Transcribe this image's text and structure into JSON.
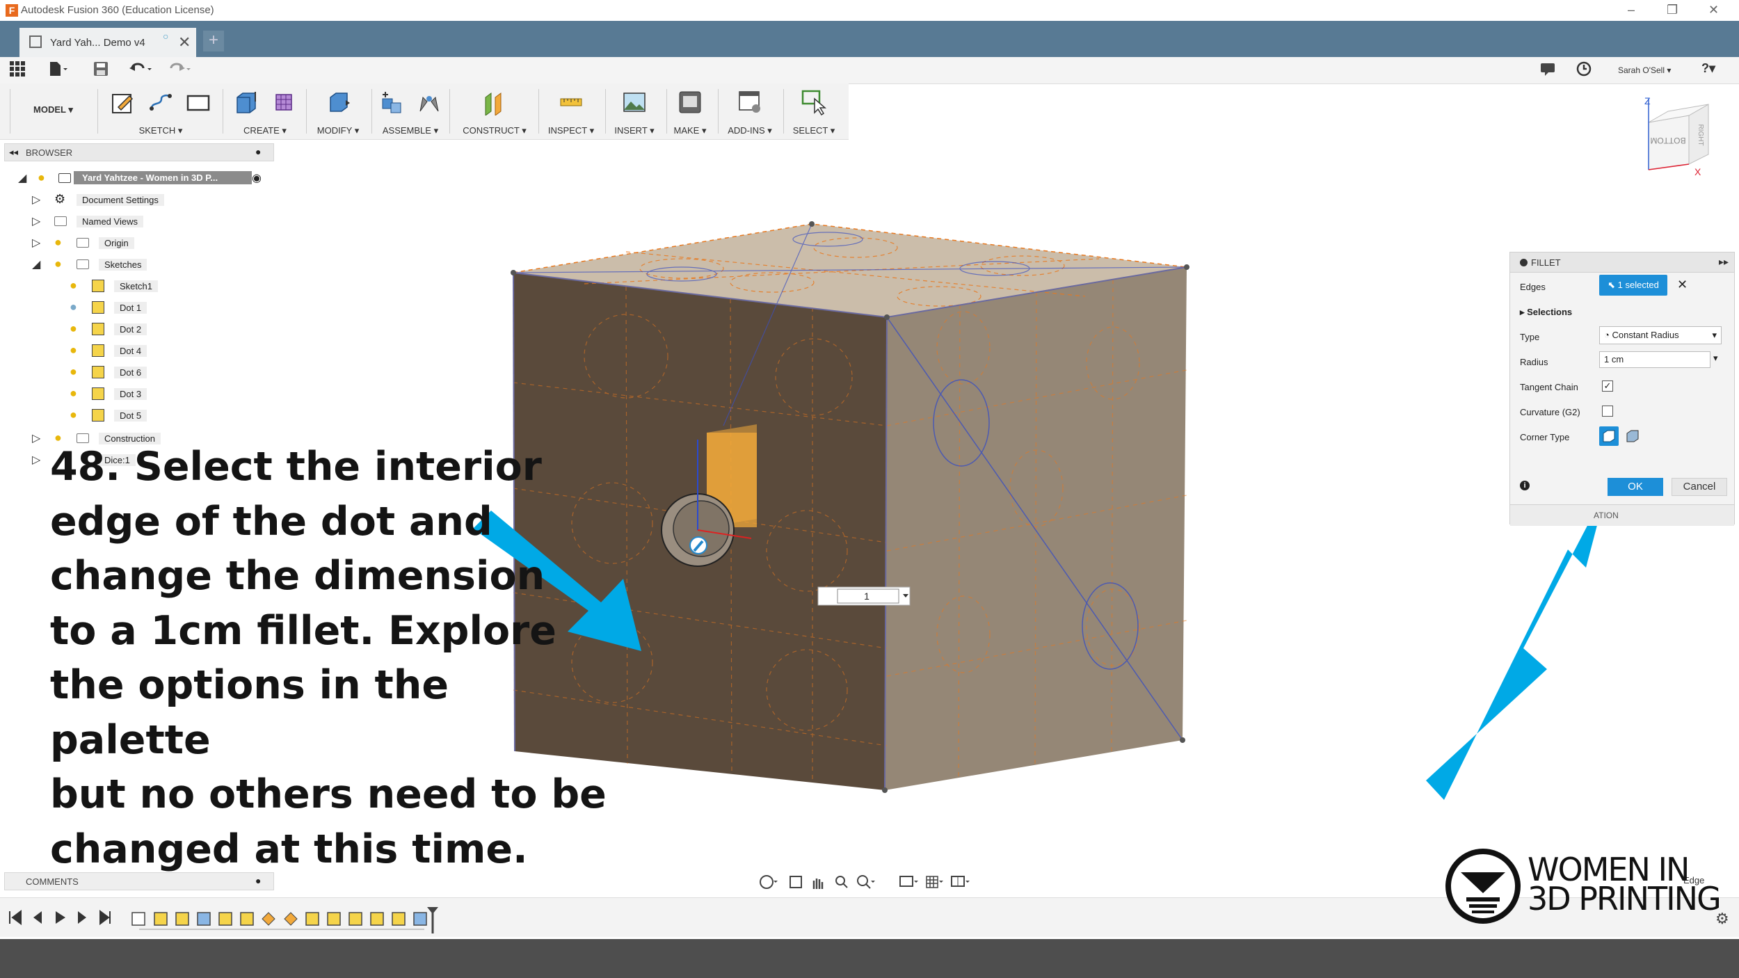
{
  "window": {
    "app_title": "Autodesk Fusion 360 (Education License)",
    "minimize": "–",
    "restore": "❐",
    "close": "✕"
  },
  "tab": {
    "label": "Yard Yah... Demo v4",
    "close": "✕",
    "new_tab": "+"
  },
  "quickbar": {
    "user": "Sarah O'Sell ▾",
    "help": "?▾"
  },
  "toolbar": {
    "workspace": "MODEL ▾",
    "groups": [
      "SKETCH ▾",
      "CREATE ▾",
      "MODIFY ▾",
      "ASSEMBLE ▾",
      "CONSTRUCT ▾",
      "INSPECT ▾",
      "INSERT ▾",
      "MAKE ▾",
      "ADD-INS ▾",
      "SELECT ▾"
    ]
  },
  "browser": {
    "header": "BROWSER",
    "root": "Yard Yahtzee - Women in 3D P...",
    "items": [
      {
        "label": "Document Settings"
      },
      {
        "label": "Named Views"
      },
      {
        "label": "Origin"
      },
      {
        "label": "Sketches"
      },
      {
        "label": "Sketch1"
      },
      {
        "label": "Dot 1"
      },
      {
        "label": "Dot 2"
      },
      {
        "label": "Dot 4"
      },
      {
        "label": "Dot 6"
      },
      {
        "label": "Dot 3"
      },
      {
        "label": "Dot 5"
      },
      {
        "label": "Construction"
      },
      {
        "label": "Dice:1"
      }
    ]
  },
  "instruction": {
    "lines": [
      "48. Select the interior",
      "edge of the dot and",
      "change the dimension",
      "to a 1cm fillet. Explore",
      "the options in the palette",
      "but no others need to be",
      "changed at this time."
    ]
  },
  "viewport": {
    "dimension_input": "1",
    "viewcube_faces": [
      "BOTTOM",
      "RIGHT"
    ],
    "axis_z": "Z",
    "axis_x": "X",
    "edge_label": "Edge"
  },
  "fillet": {
    "title": "FILLET",
    "edges_label": "Edges",
    "edges_value": "1 selected",
    "selections_label": "Selections",
    "type_label": "Type",
    "type_value": "Constant Radius",
    "radius_label": "Radius",
    "radius_value": "1 cm",
    "tangent_label": "Tangent Chain",
    "tangent_checked": true,
    "curvature_label": "Curvature (G2)",
    "curvature_checked": false,
    "corner_label": "Corner Type",
    "ok": "OK",
    "cancel": "Cancel",
    "footer": "ATION"
  },
  "comments": {
    "header": "COMMENTS"
  },
  "logo": {
    "line1": "WOMEN IN",
    "line2": "3D PRINTING"
  },
  "colors": {
    "titlebar_tab": "#587a94",
    "accent_blue": "#1d8fd8",
    "arrow_cyan": "#00a9e6",
    "sketch_orange": "#e8781e",
    "body_front": "#5a4a3b",
    "body_top": "#b8a68c"
  }
}
